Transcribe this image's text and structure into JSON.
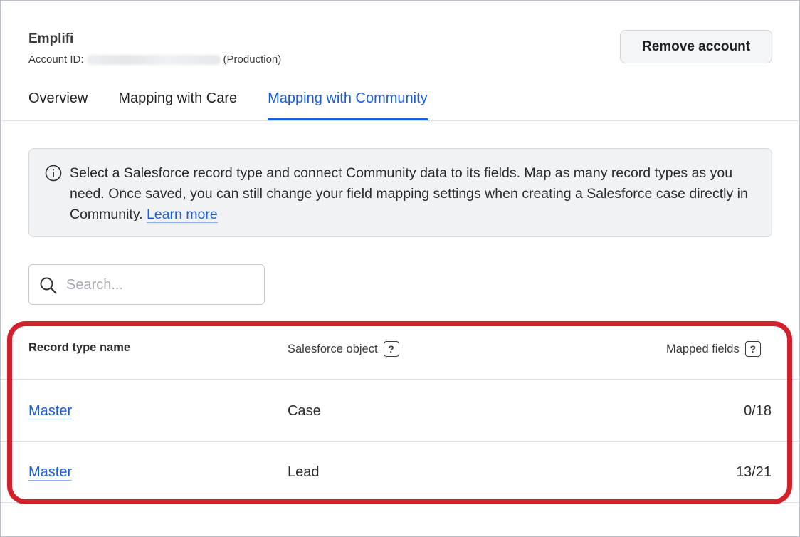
{
  "account": {
    "name": "Emplifi",
    "id_label": "Account ID:",
    "environment": "(Production)"
  },
  "header": {
    "remove_button": "Remove account"
  },
  "tabs": [
    {
      "label": "Overview",
      "active": false
    },
    {
      "label": "Mapping with Care",
      "active": false
    },
    {
      "label": "Mapping with Community",
      "active": true
    }
  ],
  "info": {
    "text": "Select a Salesforce record type and connect Community data to its fields. Map as many record types as you need. Once saved, you can still change your field mapping settings when creating a Salesforce case directly in Community. ",
    "link": "Learn more",
    "icon": "info-icon"
  },
  "search": {
    "placeholder": "Search...",
    "value": ""
  },
  "table": {
    "headers": {
      "record_type": "Record type name",
      "salesforce_object": "Salesforce object",
      "mapped_fields": "Mapped fields"
    },
    "rows": [
      {
        "record_type": "Master",
        "salesforce_object": "Case",
        "mapped_fields": "0/18"
      },
      {
        "record_type": "Master",
        "salesforce_object": "Lead",
        "mapped_fields": "13/21"
      }
    ]
  },
  "colors": {
    "accent": "#1a5ee0",
    "highlight": "#d4202b",
    "info_bg": "#f1f2f4"
  }
}
